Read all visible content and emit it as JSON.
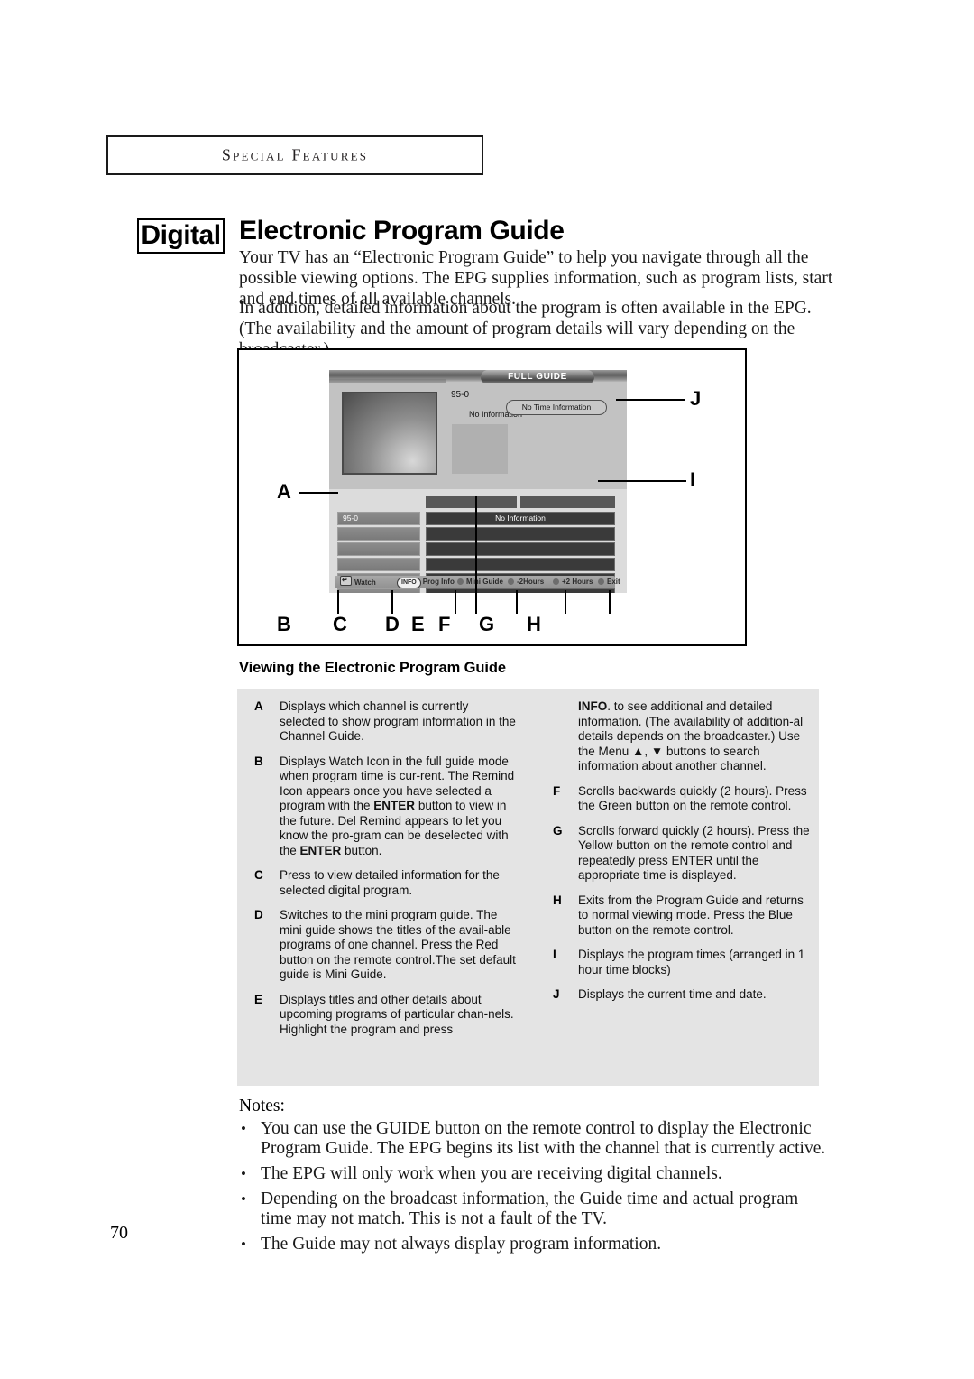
{
  "section_header": {
    "label": "Special Features"
  },
  "title": {
    "badge": "Digital",
    "heading": "Electronic Program Guide"
  },
  "intro": {
    "paragraph_1": "Your TV has an “Electronic Program Guide” to help you navigate through all the possible viewing options. The EPG supplies information, such as program lists, start and end times of all available channels.",
    "paragraph_2": "In addition, detailed information about the program is often available in the EPG. (The availability and the amount of program details will vary depending on the broadcaster.)"
  },
  "epg_screen": {
    "full_guide_tab": "FULL GUIDE",
    "channel_number": "95-0",
    "no_information_top": "No Information",
    "time_pill": "No Time Information",
    "grid_channel": "95-0",
    "grid_program": "No Information",
    "bottom_bar": [
      {
        "icon": "enter-icon",
        "label": "Watch"
      },
      {
        "icon": "info-icon",
        "label": "Prog Info"
      },
      {
        "icon": "red-dot-icon",
        "label": "Mini Guide"
      },
      {
        "icon": "green-dot-icon",
        "label": "-2Hours"
      },
      {
        "icon": "yellow-dot-icon",
        "label": "+2 Hours"
      },
      {
        "icon": "blue-dot-icon",
        "label": "Exit"
      }
    ]
  },
  "callouts": {
    "a": "A",
    "b": "B",
    "c": "C",
    "d": "D",
    "e": "E",
    "f": "F",
    "g": "G",
    "h": "H",
    "i": "I",
    "j": "J"
  },
  "sub_heading": "Viewing the Electronic Program Guide",
  "descriptions_left": [
    {
      "key": "A",
      "text": "Displays which channel is currently selected to show program information in the Channel Guide."
    },
    {
      "key": "B",
      "text_html": "Displays Watch Icon in the full guide mode when program time is cur-rent. The Remind Icon appears once you have selected a program with the <b>ENTER</b> button to view in the future.  Del Remind appears to let you know the pro-gram can be  deselected with the <b>ENTER</b> button."
    },
    {
      "key": "C",
      "text": "Press to view detailed information for the selected digital program."
    },
    {
      "key": "D",
      "text": "Switches to the mini program guide. The mini guide shows the titles of the avail-able programs of one channel. Press the Red button on the remote control.The set default guide is Mini Guide."
    },
    {
      "key": "E",
      "text": "Displays titles and other details about upcoming programs of particular chan-nels. Highlight the program and press"
    }
  ],
  "descriptions_right": [
    {
      "key": "",
      "text_html": "<b>INFO</b>. to see additional and detailed information. (The availability of addition-al details depends on the broadcaster.) Use the Menu ▲, ▼ buttons to search information about another channel."
    },
    {
      "key": "F",
      "text": "Scrolls backwards quickly (2 hours). Press the Green button  on the remote control."
    },
    {
      "key": "G",
      "text": "Scrolls forward quickly (2 hours). Press the Yellow button on the remote control and repeatedly press ENTER until the appropriate time is displayed."
    },
    {
      "key": "H",
      "text": "Exits from the Program Guide and returns to normal viewing mode. Press the Blue button on the remote control."
    },
    {
      "key": "I",
      "text": "Displays the program times (arranged in 1 hour time blocks)"
    },
    {
      "key": "J",
      "text": "Displays the current time and date."
    }
  ],
  "notes": {
    "label": "Notes:",
    "items": [
      "You can use the GUIDE button on the remote control to display the Electronic Program Guide. The EPG begins its list with the channel that is currently active.",
      "The EPG will only work when you are receiving digital channels.",
      "Depending on the broadcast information, the Guide time and actual program time may not match. This is not a fault of the TV.",
      "The Guide may not always display program information."
    ]
  },
  "page_number": "70"
}
